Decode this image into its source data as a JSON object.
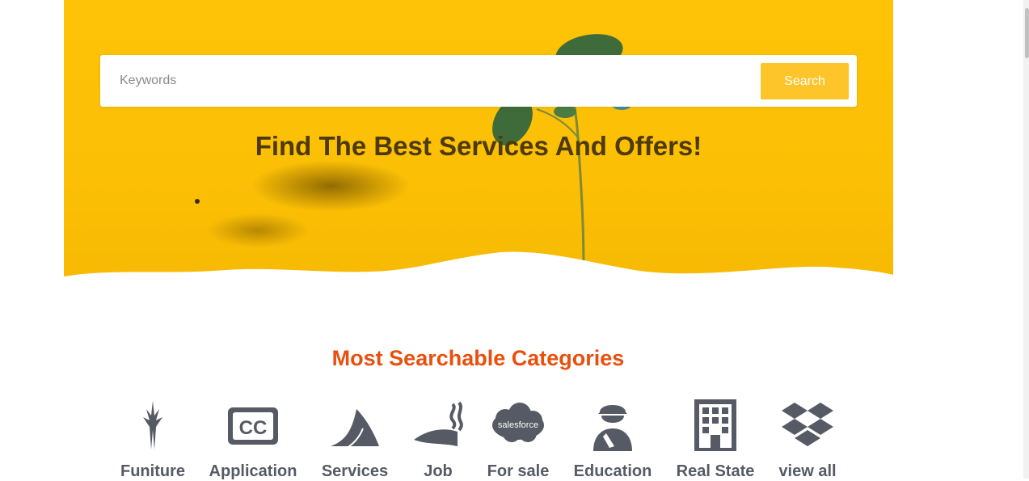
{
  "search": {
    "placeholder": "Keywords",
    "button_label": "Search"
  },
  "hero": {
    "title": "Find The Best Services And Offers!"
  },
  "categories_section": {
    "title": "Most Searchable Categories",
    "items": [
      {
        "label": "Funiture",
        "icon": "fantasy-flight-icon"
      },
      {
        "label": "Application",
        "icon": "closed-captioning-icon"
      },
      {
        "label": "Services",
        "icon": "shark-fin-icon"
      },
      {
        "label": "Job",
        "icon": "smoking-icon"
      },
      {
        "label": "For sale",
        "icon": "salesforce-icon"
      },
      {
        "label": "Education",
        "icon": "worker-icon"
      },
      {
        "label": "Real State",
        "icon": "building-icon"
      },
      {
        "label": "view all",
        "icon": "dropbox-icon"
      }
    ],
    "salesforce_text": "salesforce"
  },
  "colors": {
    "hero_yellow": "#fec307",
    "button_yellow": "#fec52a",
    "section_title": "#e8500e",
    "hero_title": "#4d3a08",
    "icon_gray": "#555a64"
  }
}
